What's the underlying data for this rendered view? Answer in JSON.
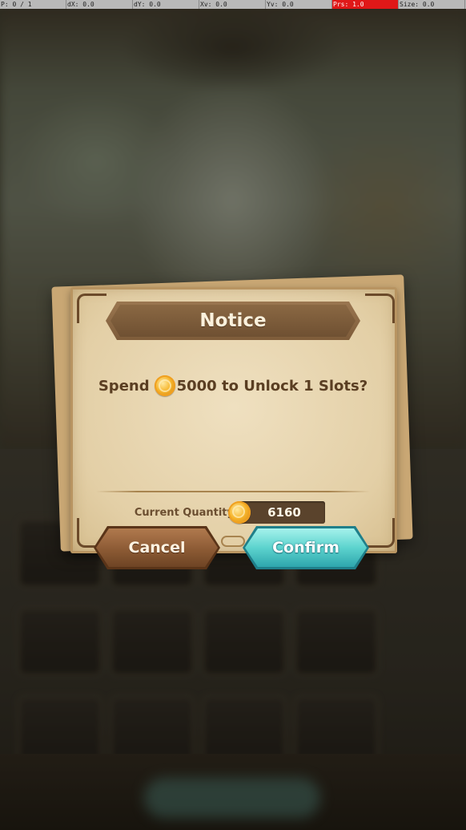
{
  "debug_bar": [
    {
      "text": "P: 0 / 1",
      "hot": false
    },
    {
      "text": "dX: 0.0",
      "hot": false
    },
    {
      "text": "dY: 0.0",
      "hot": false
    },
    {
      "text": "Xv: 0.0",
      "hot": false
    },
    {
      "text": "Yv: 0.0",
      "hot": false
    },
    {
      "text": "Prs: 1.0",
      "hot": true
    },
    {
      "text": "Size: 0.0",
      "hot": false
    }
  ],
  "dialog": {
    "title": "Notice",
    "message_prefix": "Spend ",
    "message_suffix": "5000 to Unlock 1 Slots?",
    "currency_icon": "gold-coin-icon",
    "current_quantity_label": "Current Quantity",
    "current_quantity_value": "6160",
    "cancel_label": "Cancel",
    "confirm_label": "Confirm"
  },
  "colors": {
    "paper": "#e3cfa6",
    "title_banner": "#7e5c3a",
    "cancel_button": "#8c5a34",
    "confirm_button": "#5cd3ce",
    "coin": "#f6b52b",
    "debug_highlight": "#e01818"
  }
}
